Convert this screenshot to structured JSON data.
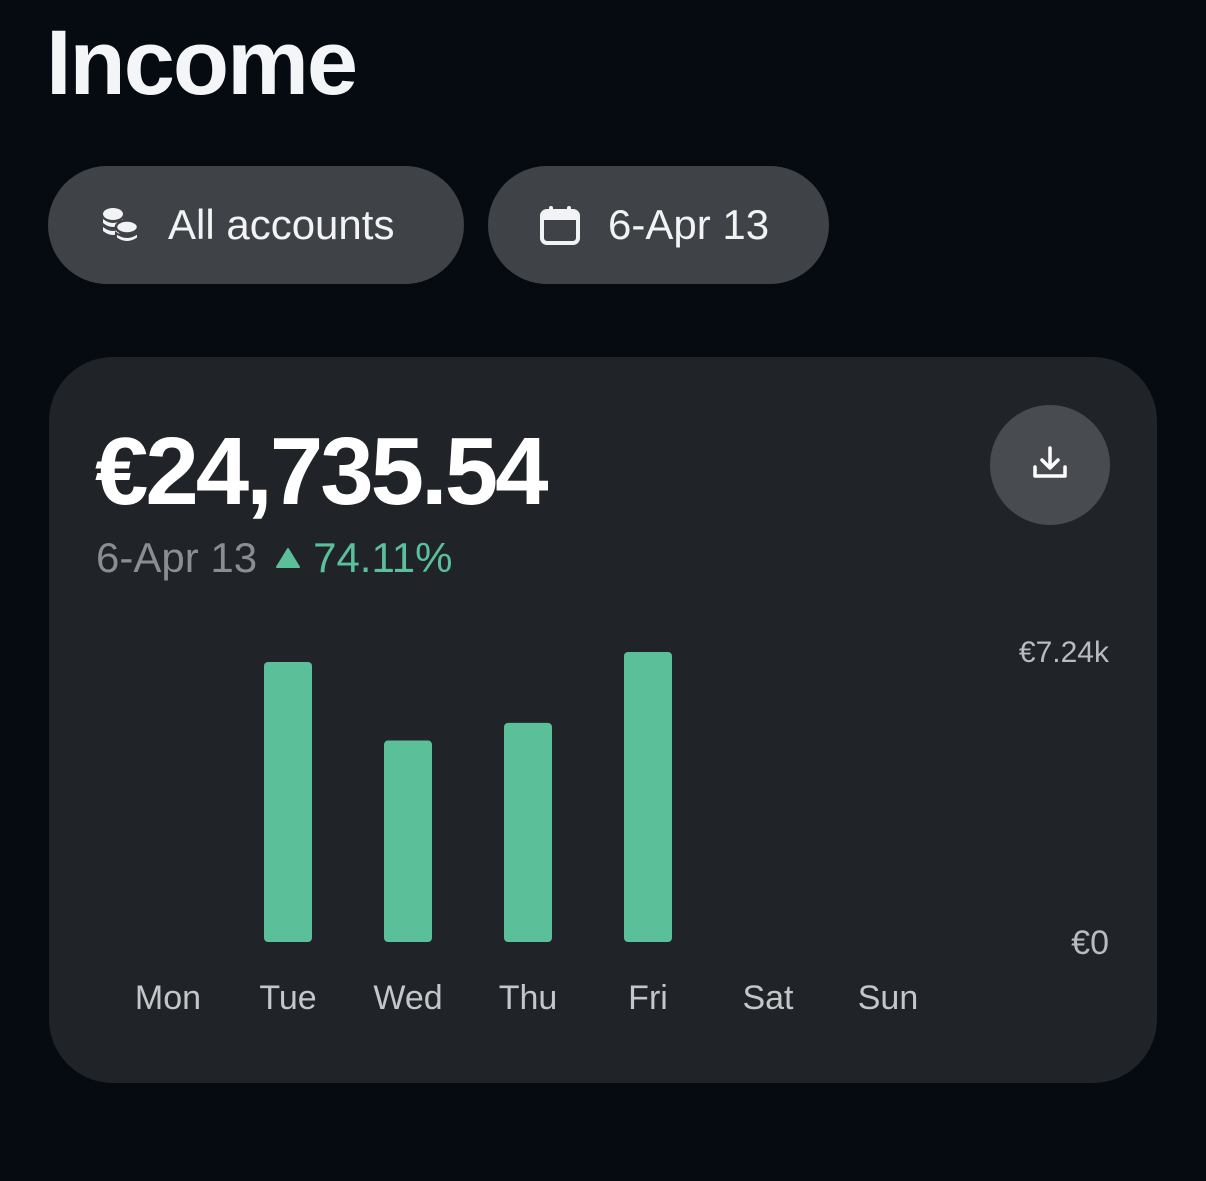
{
  "header": {
    "title": "Income"
  },
  "filters": {
    "accounts_label": "All accounts",
    "accounts_icon": "coins-icon",
    "date_label": "6-Apr 13",
    "date_icon": "calendar-icon"
  },
  "summary": {
    "total": "€24,735.54",
    "period": "6-Apr 13",
    "change": "74.11%",
    "change_direction": "up",
    "change_color": "#5bbf9a",
    "download_icon": "download-icon"
  },
  "colors": {
    "background": "#060b12",
    "card": "#202428",
    "chip": "#3f4247",
    "bar": "#5bbf9a"
  },
  "chart_data": {
    "type": "bar",
    "categories": [
      "Mon",
      "Tue",
      "Wed",
      "Thu",
      "Fri",
      "Sat",
      "Sun"
    ],
    "values": [
      0,
      6990,
      5030,
      5470,
      7240,
      0,
      0
    ],
    "ylim": [
      0,
      7240
    ],
    "y_tick_labels": [
      "€0",
      "€7.24k"
    ],
    "grid": false,
    "y_axis_position": "right"
  }
}
